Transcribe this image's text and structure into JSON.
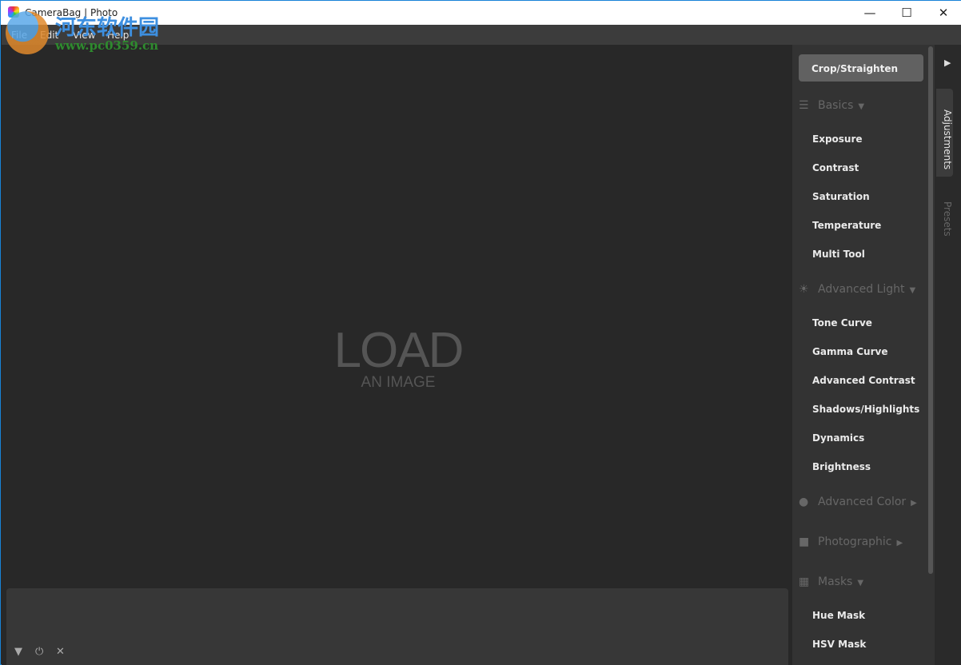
{
  "window": {
    "title": "CameraBag | Photo",
    "minimize": "—",
    "maximize": "☐",
    "close": "✕"
  },
  "watermark": {
    "text_cn": "河东软件园",
    "url": "www.pc0359.cn"
  },
  "menu": [
    "File",
    "Edit",
    "View",
    "Help"
  ],
  "canvas": {
    "load_big": "LOAD",
    "load_small": "AN IMAGE"
  },
  "bottom_icons": [
    "triangle-down-icon",
    "power-icon",
    "close-icon"
  ],
  "panel": {
    "crop_label": "Crop/Straighten",
    "sections": [
      {
        "label": "Basics",
        "icon": "sliders-icon",
        "arrow": "▼",
        "items": [
          "Exposure",
          "Contrast",
          "Saturation",
          "Temperature",
          "Multi Tool"
        ]
      },
      {
        "label": "Advanced Light",
        "icon": "sun-icon",
        "arrow": "▼",
        "items": [
          "Tone Curve",
          "Gamma Curve",
          "Advanced Contrast",
          "Shadows/Highlights",
          "Dynamics",
          "Brightness"
        ]
      },
      {
        "label": "Advanced Color",
        "icon": "color-circles-icon",
        "arrow": "▶",
        "items": []
      },
      {
        "label": "Photographic",
        "icon": "camera-icon",
        "arrow": "▶",
        "items": []
      },
      {
        "label": "Masks",
        "icon": "checker-icon",
        "arrow": "▼",
        "items": [
          "Hue Mask",
          "HSV Mask"
        ]
      }
    ]
  },
  "tabs": {
    "active": "Adjustments",
    "items": [
      "Adjustments",
      "Presets"
    ]
  },
  "colors": {
    "accent": "#1883d7",
    "panel": "#333333",
    "canvas": "#282828"
  }
}
